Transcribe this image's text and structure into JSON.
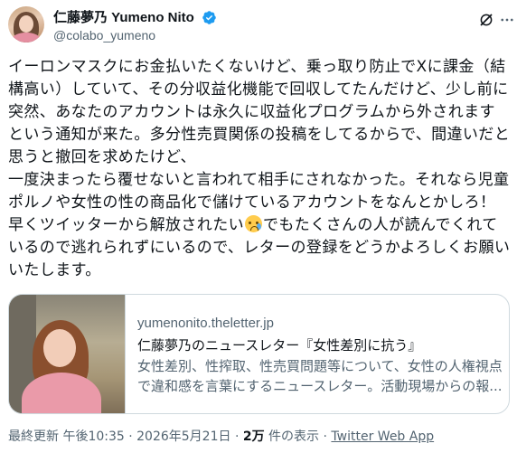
{
  "author": {
    "display_name": "仁藤夢乃 Yumeno Nito",
    "handle": "@colabo_yumeno"
  },
  "icons": {
    "verified": "verified-badge-icon",
    "grok": "grok-icon",
    "more": "more-icon",
    "emoji": "crying-face-emoji"
  },
  "colors": {
    "verified": "#1d9bf0",
    "secondary_text": "#536471",
    "border": "#cfd9de"
  },
  "tweet": {
    "text_part1": "イーロンマスクにお金払いたくないけど、乗っ取り防止でXに課金（結構高い）していて、その分収益化機能で回収してたんだけど、少し前に突然、あなたのアカウントは永久に収益化プログラムから外されますという通知が来た。多分性売買関係の投稿をしてるからで、間違いだと思うと撤回を求めたけど、\n一度決まったら覆せないと言われて相手にされなかった。それなら児童ポルノや女性の性の商品化で儲けているアカウントをなんとかしろ！早くツイッターから解放されたい",
    "text_part2": "でもたくさんの人が読んでくれているので逃れられずにいるので、レターの登録をどうかよろしくお願いいたします。"
  },
  "card": {
    "domain": "yumenonito.theletter.jp",
    "title": "仁藤夢乃のニュースレター『女性差別に抗う』",
    "desc_line1": "女性差別、性搾取、性売買問題等について、女性の人権視点",
    "desc_line2": "で違和感を言葉にするニュースレター。活動現場からの報..."
  },
  "meta": {
    "updated_label": "最終更新 午後10:35 · 2026年5月21日 · ",
    "views_count": "2万",
    "views_label": " 件の表示 · ",
    "source": "Twitter Web App"
  }
}
